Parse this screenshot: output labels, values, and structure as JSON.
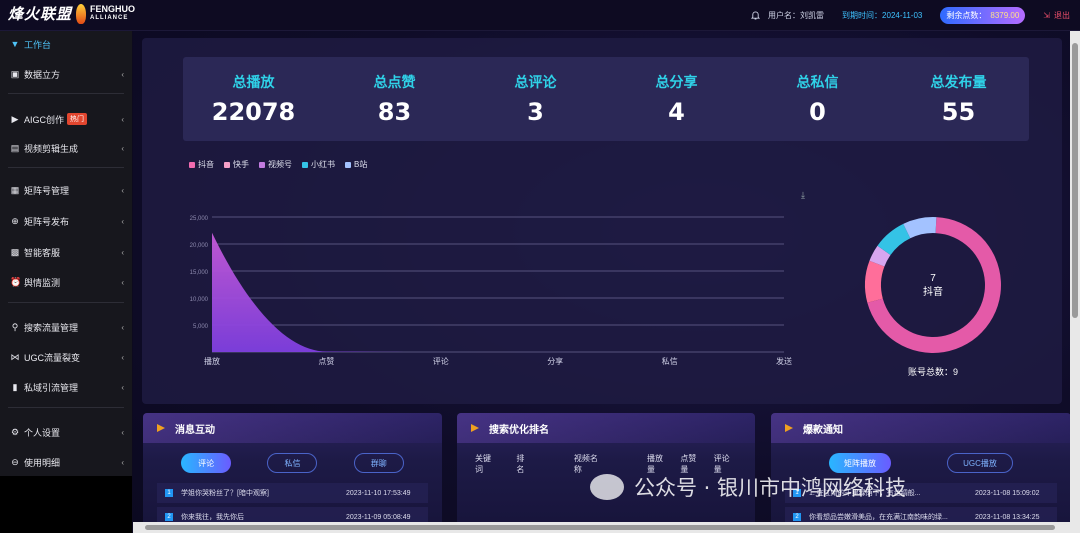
{
  "brand": {
    "cn": "烽火联盟",
    "en": "FENGHUO",
    "en_sub": "ALLIANCE"
  },
  "topbar": {
    "username_label": "用户名：刘凯雷",
    "expiry_label": "到期时间：2024-11-03",
    "points_label": "剩余点数：",
    "points_value": "8379.00",
    "logout_label": "退出"
  },
  "sidebar": {
    "items": [
      {
        "label": "工作台",
        "icon": "filter-icon"
      },
      {
        "label": "数据立方",
        "icon": "chart-icon"
      },
      {
        "label": "AIGC创作",
        "icon": "play-icon",
        "badge": "热门"
      },
      {
        "label": "视频剪辑生成",
        "icon": "film-icon"
      },
      {
        "label": "矩阵号管理",
        "icon": "grid-icon"
      },
      {
        "label": "矩阵号发布",
        "icon": "plus-icon"
      },
      {
        "label": "智能客服",
        "icon": "robot-icon"
      },
      {
        "label": "舆情监测",
        "icon": "alarm-icon"
      },
      {
        "label": "搜索流量管理",
        "icon": "search-icon"
      },
      {
        "label": "UGC流量裂变",
        "icon": "share-icon"
      },
      {
        "label": "私域引流管理",
        "icon": "bar-icon"
      },
      {
        "label": "个人设置",
        "icon": "gear-icon"
      },
      {
        "label": "使用明细",
        "icon": "minus-icon"
      }
    ]
  },
  "stats": [
    {
      "label": "总播放",
      "value": "22078"
    },
    {
      "label": "总点赞",
      "value": "83"
    },
    {
      "label": "总评论",
      "value": "3"
    },
    {
      "label": "总分享",
      "value": "4"
    },
    {
      "label": "总私信",
      "value": "0"
    },
    {
      "label": "总发布量",
      "value": "55"
    }
  ],
  "chart_data": [
    {
      "type": "area",
      "categories": [
        "播放",
        "点赞",
        "评论",
        "分享",
        "私信",
        "发送"
      ],
      "series": [
        {
          "name": "抖音",
          "values": [
            22078,
            83,
            3,
            4,
            0,
            0
          ],
          "color": "#8e44e8"
        }
      ],
      "legend": [
        {
          "name": "抖音",
          "color": "#f06bb0"
        },
        {
          "name": "快手",
          "color": "#f5a0c8"
        },
        {
          "name": "视频号",
          "color": "#c27be0"
        },
        {
          "name": "小红书",
          "color": "#34c3e6"
        },
        {
          "name": "B站",
          "color": "#a3c2ff"
        }
      ],
      "yticks": [
        "25,000",
        "20,000",
        "15,000",
        "10,000",
        "5,000"
      ],
      "ylim": [
        0,
        25000
      ],
      "legend_position": "top-left"
    },
    {
      "type": "pie",
      "slices": [
        {
          "name": "抖音",
          "value": 7,
          "color": "#e45aa8"
        },
        {
          "name": "快手",
          "value": 1,
          "color": "#ff6e9a"
        },
        {
          "name": "视频号",
          "value": 0.4,
          "color": "#d7a6f0"
        },
        {
          "name": "小红书",
          "value": 0.8,
          "color": "#34c3e6"
        },
        {
          "name": "B站",
          "value": 0.8,
          "color": "#a3c2ff"
        }
      ],
      "center_value": "7",
      "center_label": "抖音",
      "total_label": "账号总数：9"
    }
  ],
  "cards": {
    "messages": {
      "title": "消息互动",
      "tabs": [
        "评论",
        "私信",
        "群聊"
      ],
      "rows": [
        {
          "no": "1",
          "text": "学姐你哭粉丝了？[暗中观察]",
          "time": "2023-11-10 17:53:49"
        },
        {
          "no": "2",
          "text": "你来我往，我先你后",
          "time": "2023-11-09 05:08:49"
        }
      ]
    },
    "search": {
      "title": "搜索优化排名",
      "columns": [
        "关键词",
        "排名",
        "视频名称",
        "播放量",
        "点赞量",
        "评论量"
      ]
    },
    "hot": {
      "title": "爆款通知",
      "tabs": [
        "矩阵播放",
        "UGC播放"
      ],
      "rows": [
        {
          "no": "1",
          "text": "1. 在江南的十里绿荫下，有丝绸般...",
          "time": "2023-11-08 15:09:02"
        },
        {
          "no": "2",
          "text": "你看想品尝嫩滑美品，在充满江南韵味的绿...",
          "time": "2023-11-08 13:34:25"
        }
      ]
    }
  },
  "watermark": "公众号 · 银川市中鸿网络科技"
}
